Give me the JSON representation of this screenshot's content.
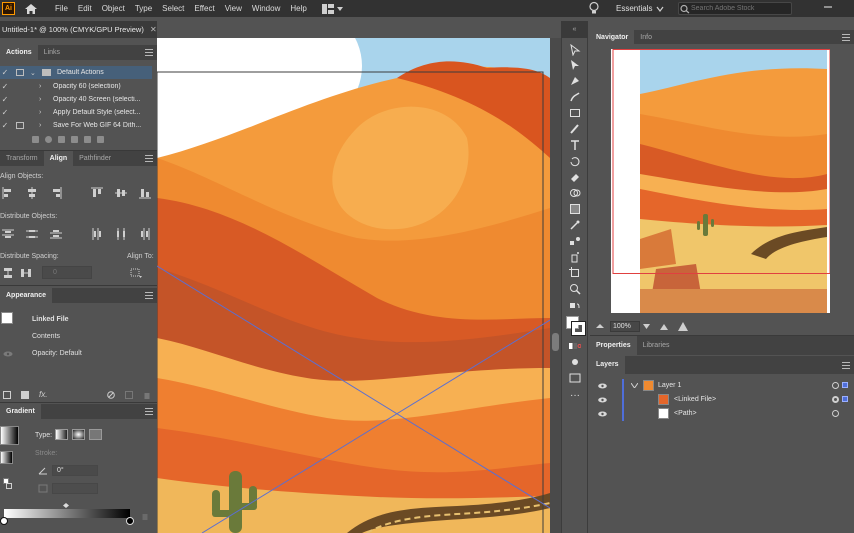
{
  "app": {
    "logo_text": "Ai",
    "menu": [
      "File",
      "Edit",
      "Object",
      "Type",
      "Select",
      "Effect",
      "View",
      "Window",
      "Help"
    ],
    "workspace": "Essentials",
    "search_placeholder": "Search Adobe Stock"
  },
  "document": {
    "tab_title": "Untitled-1* @ 100% (CMYK/GPU Preview)"
  },
  "actions_panel": {
    "tabs": [
      "Actions",
      "Links"
    ],
    "rows": [
      {
        "label": "Default Actions",
        "type": "folder",
        "selected": true
      },
      {
        "label": "Opacity 60 (selection)",
        "type": "action"
      },
      {
        "label": "Opacity 40 Screen (selecti...",
        "type": "action"
      },
      {
        "label": "Apply Default Style (select...",
        "type": "action"
      },
      {
        "label": "Save For Web GIF 64 Dith...",
        "type": "action"
      }
    ]
  },
  "align_panel": {
    "tabs": [
      "Transform",
      "Align",
      "Pathfinder"
    ],
    "align_objects": "Align Objects:",
    "distribute_objects": "Distribute Objects:",
    "distribute_spacing": "Distribute Spacing:",
    "align_to": "Align To:",
    "spacing_value": "0"
  },
  "appearance_panel": {
    "title": "Appearance",
    "item": "Linked File",
    "contents": "Contents",
    "opacity": "Opacity: Default"
  },
  "gradient_panel": {
    "title": "Gradient",
    "type_label": "Type:",
    "stroke_label": "Stroke:",
    "angle_value": "0°"
  },
  "navigator_panel": {
    "tabs": [
      "Navigator",
      "Info"
    ],
    "zoom": "100%"
  },
  "properties_panel": {
    "tabs": [
      "Properties",
      "Libraries"
    ]
  },
  "layers_panel": {
    "title": "Layers",
    "rows": [
      {
        "name": "Layer 1",
        "indent": 0
      },
      {
        "name": "<Linked File>",
        "indent": 1
      },
      {
        "name": "<Path>",
        "indent": 1
      }
    ]
  },
  "colors": {
    "sky": "#a9d4ec",
    "sand_light": "#f7b052",
    "sand_mid": "#ef8a30",
    "sand_dark": "#d85a25",
    "cactus": "#6a7a3a",
    "selection_blue": "#4f6ed9"
  }
}
